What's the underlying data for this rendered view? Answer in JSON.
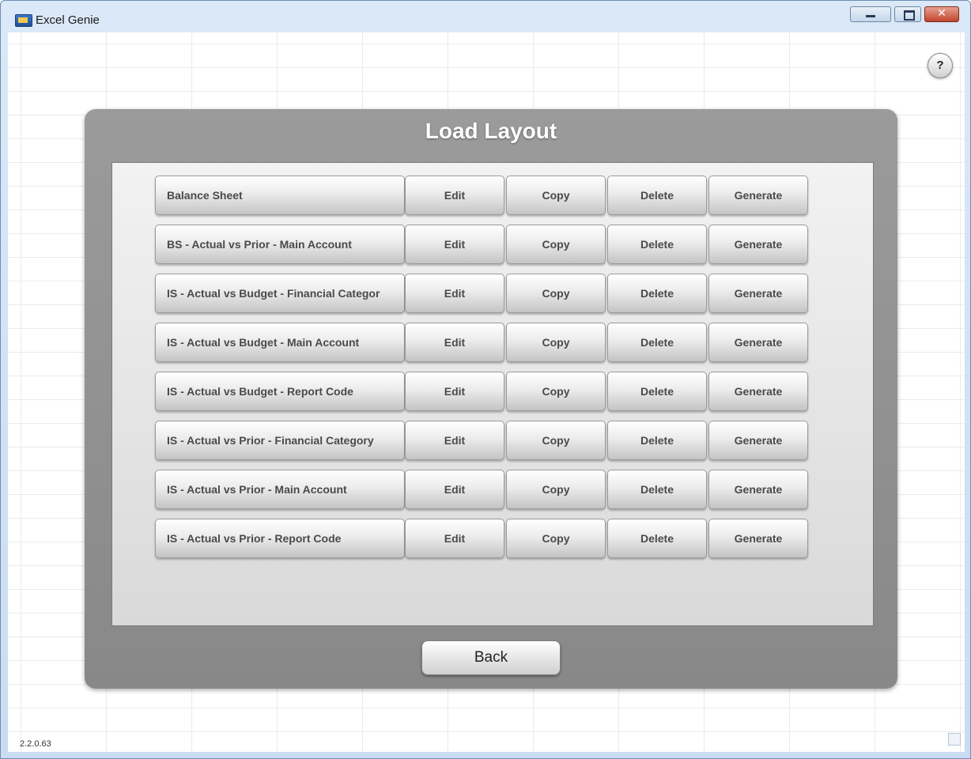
{
  "window": {
    "title": "Excel Genie",
    "help_label": "?",
    "version": "2.2.0.63",
    "close_label": "✕"
  },
  "panel": {
    "title": "Load Layout",
    "back_label": "Back",
    "buttons": {
      "edit": "Edit",
      "copy": "Copy",
      "delete": "Delete",
      "generate": "Generate"
    },
    "layouts": [
      "Balance Sheet",
      "BS - Actual vs Prior - Main Account",
      "IS - Actual vs Budget - Financial Categor",
      "IS - Actual vs Budget - Main Account",
      "IS - Actual vs Budget - Report Code",
      "IS - Actual vs Prior - Financial Category",
      "IS - Actual vs Prior - Main Account",
      "IS - Actual vs Prior - Report Code"
    ]
  },
  "icons": {
    "app": "excel-genie-app-icon",
    "minimize": "minimize-icon",
    "maximize": "maximize-icon",
    "close": "close-icon",
    "help": "help-icon"
  }
}
